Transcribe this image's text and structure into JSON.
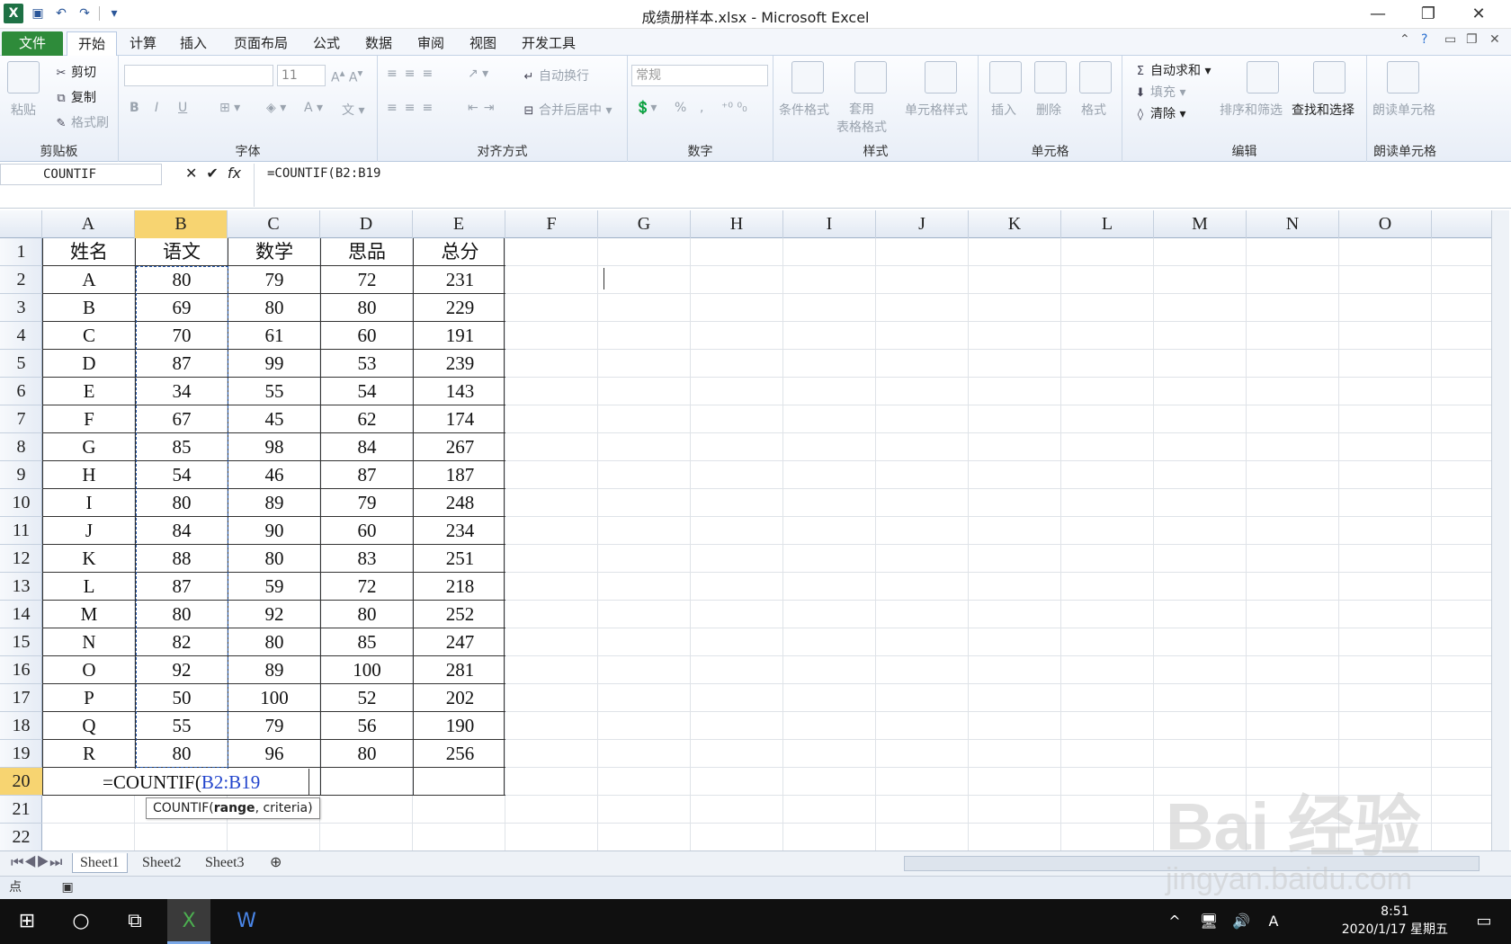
{
  "window": {
    "title": "成绩册样本.xlsx - Microsoft Excel"
  },
  "menubar": {
    "tabs": [
      "文件",
      "开始",
      "计算",
      "插入",
      "页面布局",
      "公式",
      "数据",
      "审阅",
      "视图",
      "开发工具"
    ]
  },
  "ribbon": {
    "clipboard": {
      "paste": "粘贴",
      "cut": "剪切",
      "copy": "复制",
      "format_painter": "格式刷",
      "label": "剪贴板"
    },
    "font": {
      "size": "11",
      "label": "字体",
      "bold": "B",
      "italic": "I",
      "underline": "U"
    },
    "alignment": {
      "wrap": "自动换行",
      "merge": "合并后居中",
      "label": "对齐方式"
    },
    "number": {
      "format": "常规",
      "percent": "%",
      "comma": ",",
      "label": "数字"
    },
    "styles": {
      "cond": "条件格式",
      "table": "套用\n表格格式",
      "cell": "单元格样式",
      "label": "样式"
    },
    "cells": {
      "insert": "插入",
      "delete": "删除",
      "format": "格式",
      "label": "单元格"
    },
    "editing": {
      "autosum": "自动求和",
      "fill": "填充",
      "clear": "清除",
      "sort": "排序和筛选",
      "find": "查找和选择",
      "label": "编辑"
    },
    "read": {
      "btn": "朗读单元格",
      "label": "朗读单元格"
    }
  },
  "formula_bar": {
    "name_box": "COUNTIF",
    "formula": "=COUNTIF(B2:B19"
  },
  "columns": [
    "A",
    "B",
    "C",
    "D",
    "E",
    "F",
    "G",
    "H",
    "I",
    "J",
    "K",
    "L",
    "M",
    "N",
    "O"
  ],
  "rows": [
    "1",
    "2",
    "3",
    "4",
    "5",
    "6",
    "7",
    "8",
    "9",
    "10",
    "11",
    "12",
    "13",
    "14",
    "15",
    "16",
    "17",
    "18",
    "19",
    "20",
    "21",
    "22"
  ],
  "table": {
    "header": [
      "姓名",
      "语文",
      "数学",
      "思品",
      "总分"
    ],
    "data": [
      [
        "A",
        "80",
        "79",
        "72",
        "231"
      ],
      [
        "B",
        "69",
        "80",
        "80",
        "229"
      ],
      [
        "C",
        "70",
        "61",
        "60",
        "191"
      ],
      [
        "D",
        "87",
        "99",
        "53",
        "239"
      ],
      [
        "E",
        "34",
        "55",
        "54",
        "143"
      ],
      [
        "F",
        "67",
        "45",
        "62",
        "174"
      ],
      [
        "G",
        "85",
        "98",
        "84",
        "267"
      ],
      [
        "H",
        "54",
        "46",
        "87",
        "187"
      ],
      [
        "I",
        "80",
        "89",
        "79",
        "248"
      ],
      [
        "J",
        "84",
        "90",
        "60",
        "234"
      ],
      [
        "K",
        "88",
        "80",
        "83",
        "251"
      ],
      [
        "L",
        "87",
        "59",
        "72",
        "218"
      ],
      [
        "M",
        "80",
        "92",
        "80",
        "252"
      ],
      [
        "N",
        "82",
        "80",
        "85",
        "247"
      ],
      [
        "O",
        "92",
        "89",
        "100",
        "281"
      ],
      [
        "P",
        "50",
        "100",
        "52",
        "202"
      ],
      [
        "Q",
        "55",
        "79",
        "56",
        "190"
      ],
      [
        "R",
        "80",
        "96",
        "80",
        "256"
      ]
    ]
  },
  "editing_cell": {
    "prefix": "=COUNTIF(",
    "ref": "B2:B19"
  },
  "tooltip": {
    "fn": "COUNTIF(",
    "arg1": "range",
    ",": ",",
    "rest": ", criteria)"
  },
  "sheets": [
    "Sheet1",
    "Sheet2",
    "Sheet3"
  ],
  "status": {
    "mode": "点"
  },
  "taskbar": {
    "time": "8:51",
    "date": "2020/1/17 星期五"
  },
  "watermark": {
    "line1": "Bai 经验",
    "line2": "jingyan.baidu.com"
  }
}
